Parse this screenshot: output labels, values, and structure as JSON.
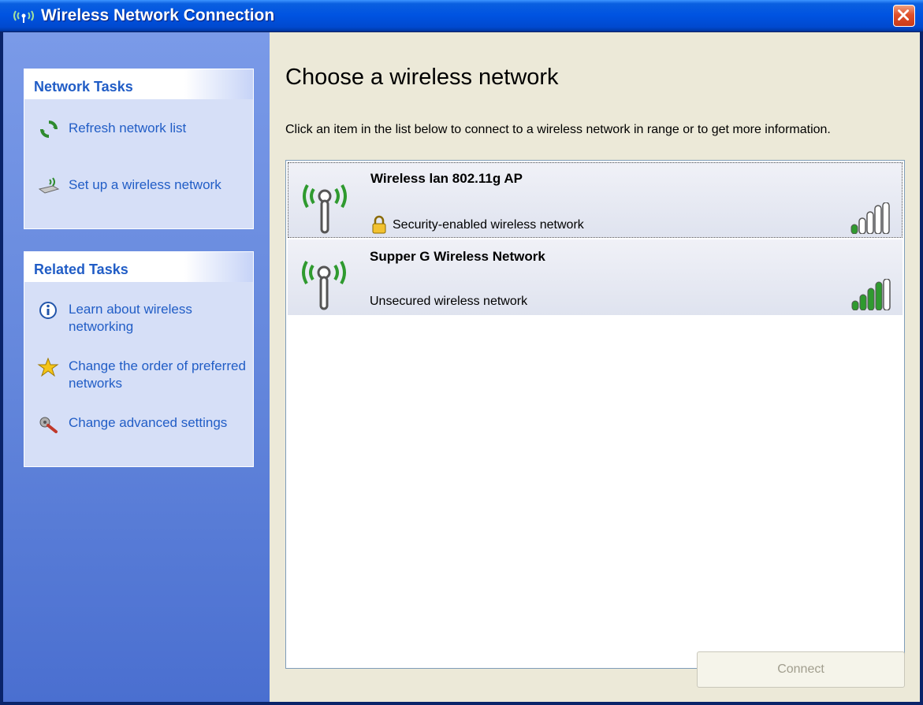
{
  "window": {
    "title": "Wireless Network Connection"
  },
  "sidebar": {
    "network_tasks": {
      "header": "Network Tasks",
      "items": [
        {
          "label": "Refresh network list",
          "icon": "refresh-icon"
        },
        {
          "label": "Set up a wireless network",
          "icon": "setup-wireless-icon"
        }
      ]
    },
    "related_tasks": {
      "header": "Related Tasks",
      "items": [
        {
          "label": "Learn about wireless networking",
          "icon": "info-icon"
        },
        {
          "label": "Change the order of preferred networks",
          "icon": "star-icon"
        },
        {
          "label": "Change advanced settings",
          "icon": "settings-icon"
        }
      ]
    }
  },
  "main": {
    "title": "Choose a wireless network",
    "description": "Click an item in the list below to connect to a wireless network in range or to get more information.",
    "networks": [
      {
        "name": "Wireless lan 802.11g AP",
        "status": "Security-enabled wireless network",
        "secured": true,
        "signal_bars": 1,
        "selected": true
      },
      {
        "name": "Supper G Wireless Network",
        "status": "Unsecured wireless network",
        "secured": false,
        "signal_bars": 4,
        "selected": false
      }
    ],
    "connect_label": "Connect"
  },
  "colors": {
    "titlebar": "#0053e1",
    "sidebar": "#6487dc",
    "link": "#215dc6",
    "signal_on": "#2f9a2f"
  }
}
